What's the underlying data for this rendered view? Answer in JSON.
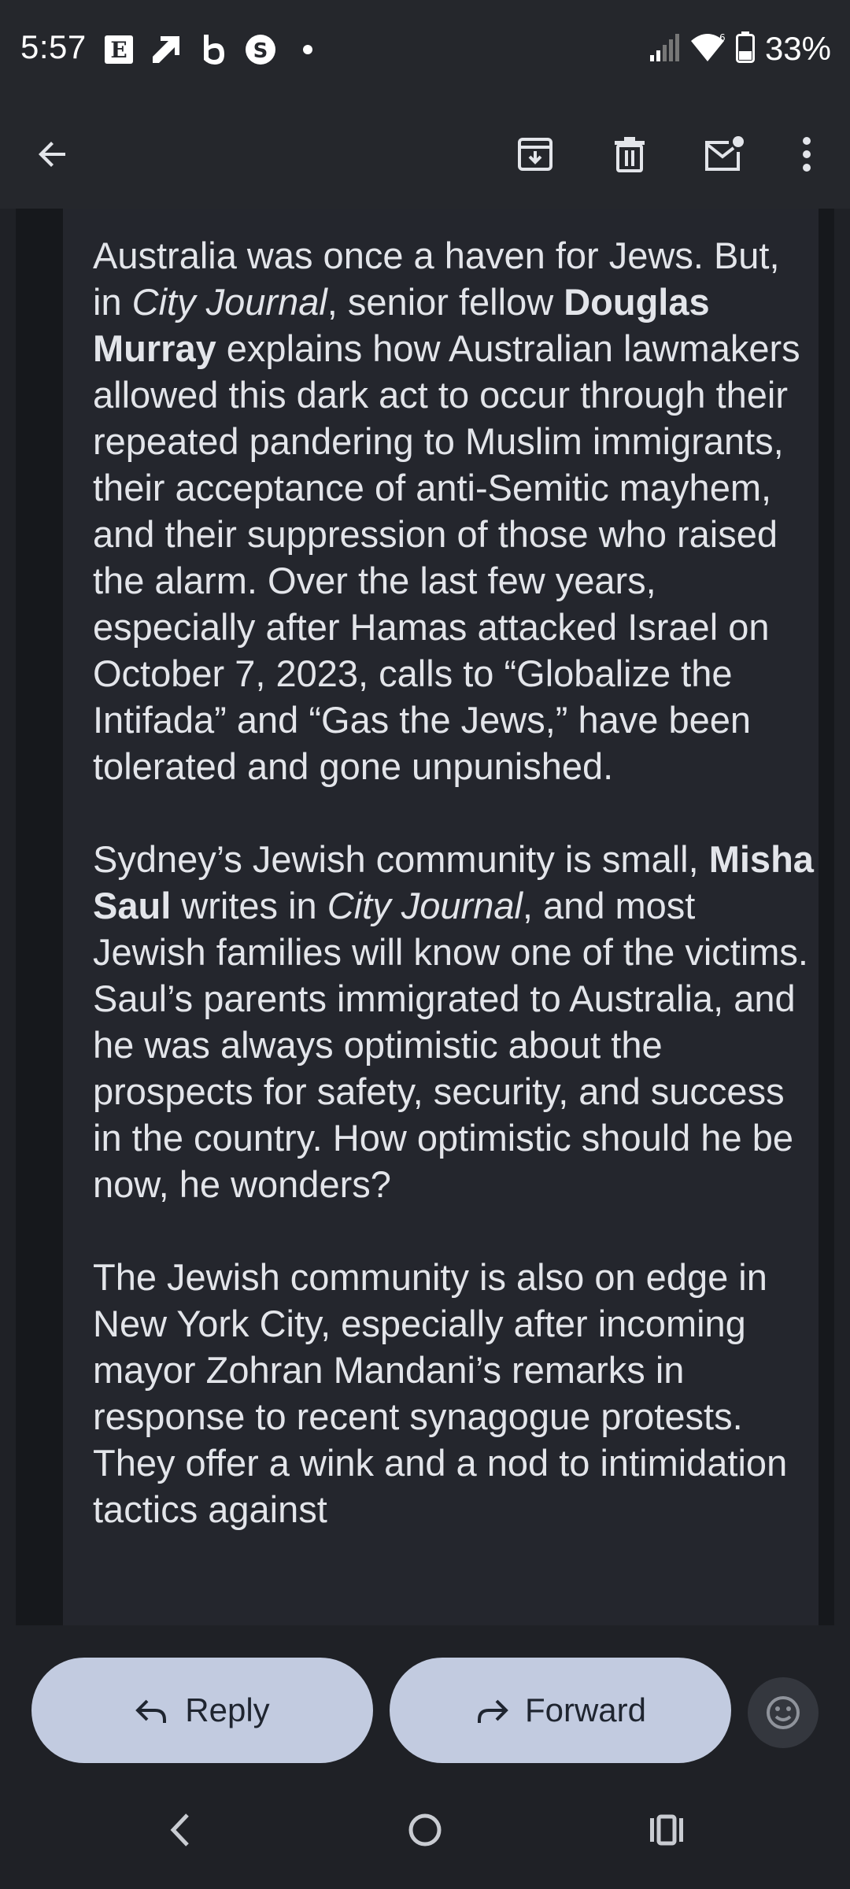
{
  "status_bar": {
    "time": "5:57",
    "notification_icons": [
      "e-app-icon",
      "trending-icon",
      "b-app-icon",
      "s-app-icon",
      "dot-icon"
    ],
    "battery_percent": "33%"
  },
  "app_bar": {
    "icons": [
      "back-arrow-icon",
      "archive-icon",
      "delete-icon",
      "mark-unread-icon",
      "more-vert-icon"
    ]
  },
  "email": {
    "p1": {
      "t1": "Australia was once a haven for Jews. But, in ",
      "em1": "City Journal",
      "t2": ", senior fellow ",
      "b1": "Douglas Murray",
      "t3": " explains how Australian lawmakers allowed this dark act to occur through their repeated pandering to Muslim immigrants, their acceptance of anti-Semitic mayhem, and their suppression of those who raised the alarm. Over the last few years, especially after Hamas attacked Israel on October 7, 2023, calls to “Globalize the Intifada” and “Gas the Jews,” have been tolerated and gone unpunished."
    },
    "p2": {
      "t1": "Sydney’s Jewish community is small, ",
      "b1": "Misha Saul",
      "t2": " writes in ",
      "em1": "City Journal",
      "t3": ", and most Jewish families will know one of the victims. Saul’s parents immigrated to Australia, and he was always optimistic about the prospects for safety, security, and success in the country. How optimistic should he be now, he wonders?"
    },
    "p3": {
      "t1": "The Jewish community is also on edge in New York City, especially after incoming mayor Zohran Mandani’s remarks in response to recent synagogue protests. They offer a wink and a nod to intimidation tactics against"
    }
  },
  "actions": {
    "reply_label": "Reply",
    "forward_label": "Forward"
  },
  "colors": {
    "pill_bg": "#c2cbe0",
    "text": "#e3e5ea",
    "background": "#1f2126"
  }
}
